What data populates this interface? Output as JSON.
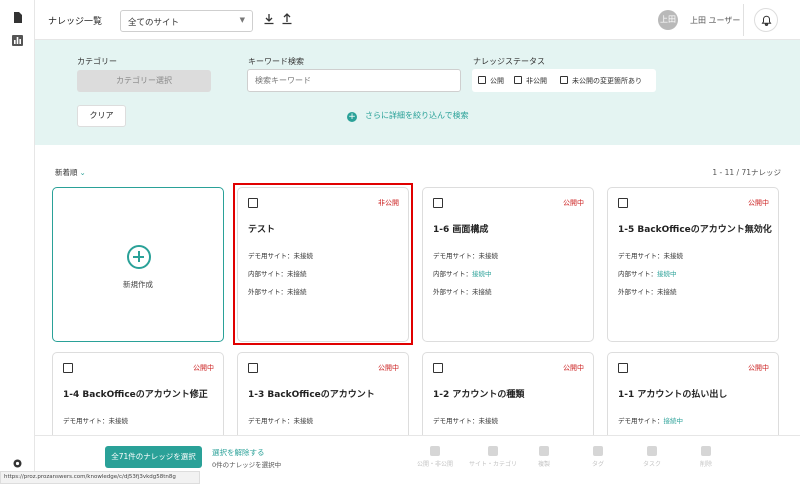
{
  "header": {
    "title": "ナレッジ一覧",
    "site_select": "全てのサイト",
    "avatar_initials": "上田",
    "username": "上田 ユーザー"
  },
  "filter": {
    "category_label": "カテゴリー",
    "category_button": "カテゴリー選択",
    "keyword_label": "キーワード検索",
    "keyword_placeholder": "検索キーワード",
    "status_label": "ナレッジステータス",
    "status_public": "公開",
    "status_private": "非公開",
    "status_unpublished_changes": "未公開の変更箇所あり",
    "clear_button": "クリア",
    "advanced_search": "さらに詳細を絞り込んで検索"
  },
  "list": {
    "sort_label": "新着順",
    "count": "1 - 11 / 71ナレッジ",
    "new_card_label": "新規作成",
    "cards": [
      {
        "badge": "非公開",
        "title": "テスト",
        "demo_label": "デモ用サイト：",
        "demo_value": "未接続",
        "internal_label": "内部サイト：",
        "internal_value": "未接続",
        "external_label": "外部サイト：",
        "external_value": "未接続"
      },
      {
        "badge": "公開中",
        "title": "1-6 画面構成",
        "demo_label": "デモ用サイト：",
        "demo_value": "未接続",
        "internal_label": "内部サイト：",
        "internal_value": "接続中",
        "external_label": "外部サイト：",
        "external_value": "未接続"
      },
      {
        "badge": "公開中",
        "title": "1-5 BackOfficeのアカウント無効化",
        "demo_label": "デモ用サイト：",
        "demo_value": "未接続",
        "internal_label": "内部サイト：",
        "internal_value": "接続中",
        "external_label": "外部サイト：",
        "external_value": "未接続"
      },
      {
        "badge": "公開中",
        "title": "1-4 BackOfficeのアカウント修正",
        "demo_label": "デモ用サイト：",
        "demo_value": "未接続"
      },
      {
        "badge": "公開中",
        "title": "1-3 BackOfficeのアカウント",
        "demo_label": "デモ用サイト：",
        "demo_value": "未接続"
      },
      {
        "badge": "公開中",
        "title": "1-2 アカウントの種類",
        "demo_label": "デモ用サイト：",
        "demo_value": "未接続"
      },
      {
        "badge": "公開中",
        "title": "1-1 アカウントの払い出し",
        "demo_label": "デモ用サイト：",
        "demo_value": "接続中"
      }
    ]
  },
  "bottom": {
    "select_all": "全71件のナレッジを選択",
    "deselect": "選択を解除する",
    "selected_count": "0件のナレッジを選択中",
    "actions": [
      "公開・非公開",
      "サイト・カテゴリ",
      "複製",
      "タグ",
      "タスク",
      "削除"
    ]
  },
  "status_url": "https://proz.prozanswers.com/knowledge/c/dj53fj3vkdg58tn8g",
  "colors": {
    "accent": "#2aa198",
    "badge_red": "#cc2222",
    "filter_bg": "#e4f4f2",
    "highlight": "#e00000"
  }
}
